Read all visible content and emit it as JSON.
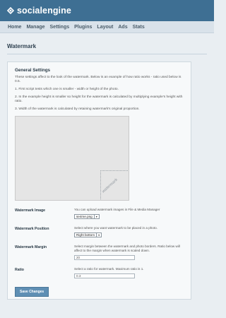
{
  "brand": {
    "name": "socialengine"
  },
  "nav": [
    "Home",
    "Manage",
    "Settings",
    "Plugins",
    "Layout",
    "Ads",
    "Stats"
  ],
  "page": {
    "title": "Watermark"
  },
  "panel": {
    "heading": "General Settings",
    "intro": "These settings affect to the look of the watermark. Below is an example of how ratio works - ratio used below is 0.5.",
    "notes": [
      "1. First script tests which one is smaller - width or height of the photo.",
      "2. In the example height is smaller so height for the watermark is calculated by multiplying example's height with ratio.",
      "3. Width of the watermark is calculated by retaining watermark's original proportion."
    ],
    "watermark_sample": "watermark"
  },
  "fields": {
    "image": {
      "label": "Watermark Image",
      "help": "You can upload watermark images in File & Media Manager",
      "value": "se4me.png"
    },
    "position": {
      "label": "Watermark Position",
      "help": "Select where you want watermark to be placed in a photo.",
      "value": "Right bottom"
    },
    "margin": {
      "label": "Watermark Margin",
      "help": "Select margin between the watermark and photo borders. Ratio below will affect to the margin when watermark is scaled down.",
      "value": "20"
    },
    "ratio": {
      "label": "Ratio",
      "help": "Select a ratio for watermark. Maximum ratio is 1.",
      "value": "0.3"
    }
  },
  "actions": {
    "save": "Save Changes"
  }
}
